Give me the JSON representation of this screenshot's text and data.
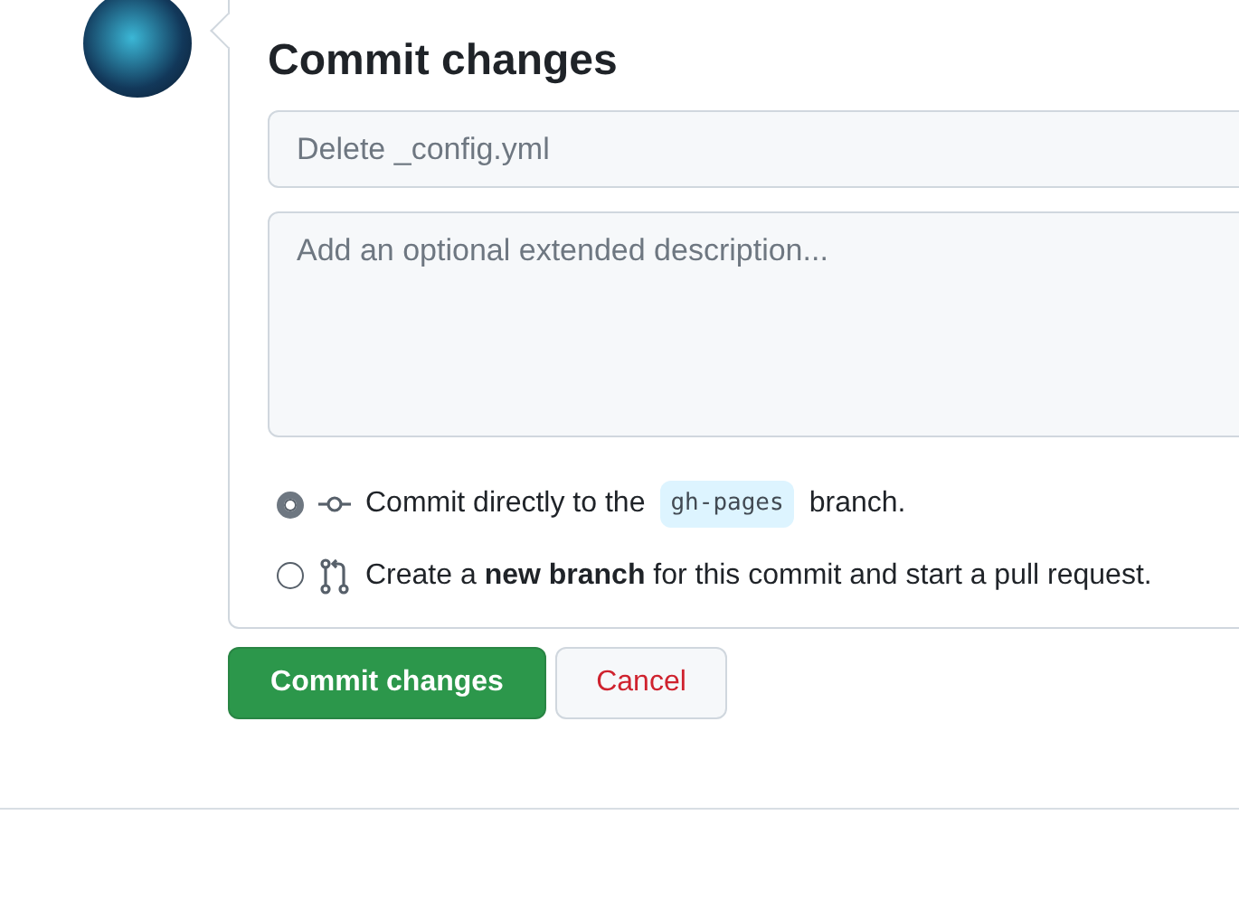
{
  "title": "Commit changes",
  "summary": {
    "placeholder": "Delete _config.yml"
  },
  "description": {
    "placeholder": "Add an optional extended description..."
  },
  "options": [
    {
      "kind": "direct",
      "selected": true,
      "text_before": "Commit directly to the",
      "branch": "gh-pages",
      "text_after": "branch."
    },
    {
      "kind": "new_branch",
      "selected": false,
      "text": "Create a **new branch** for this commit and start a pull request."
    }
  ],
  "buttons": [
    {
      "kind": "primary",
      "label": "Commit changes"
    },
    {
      "kind": "cancel",
      "label": "Cancel"
    }
  ]
}
